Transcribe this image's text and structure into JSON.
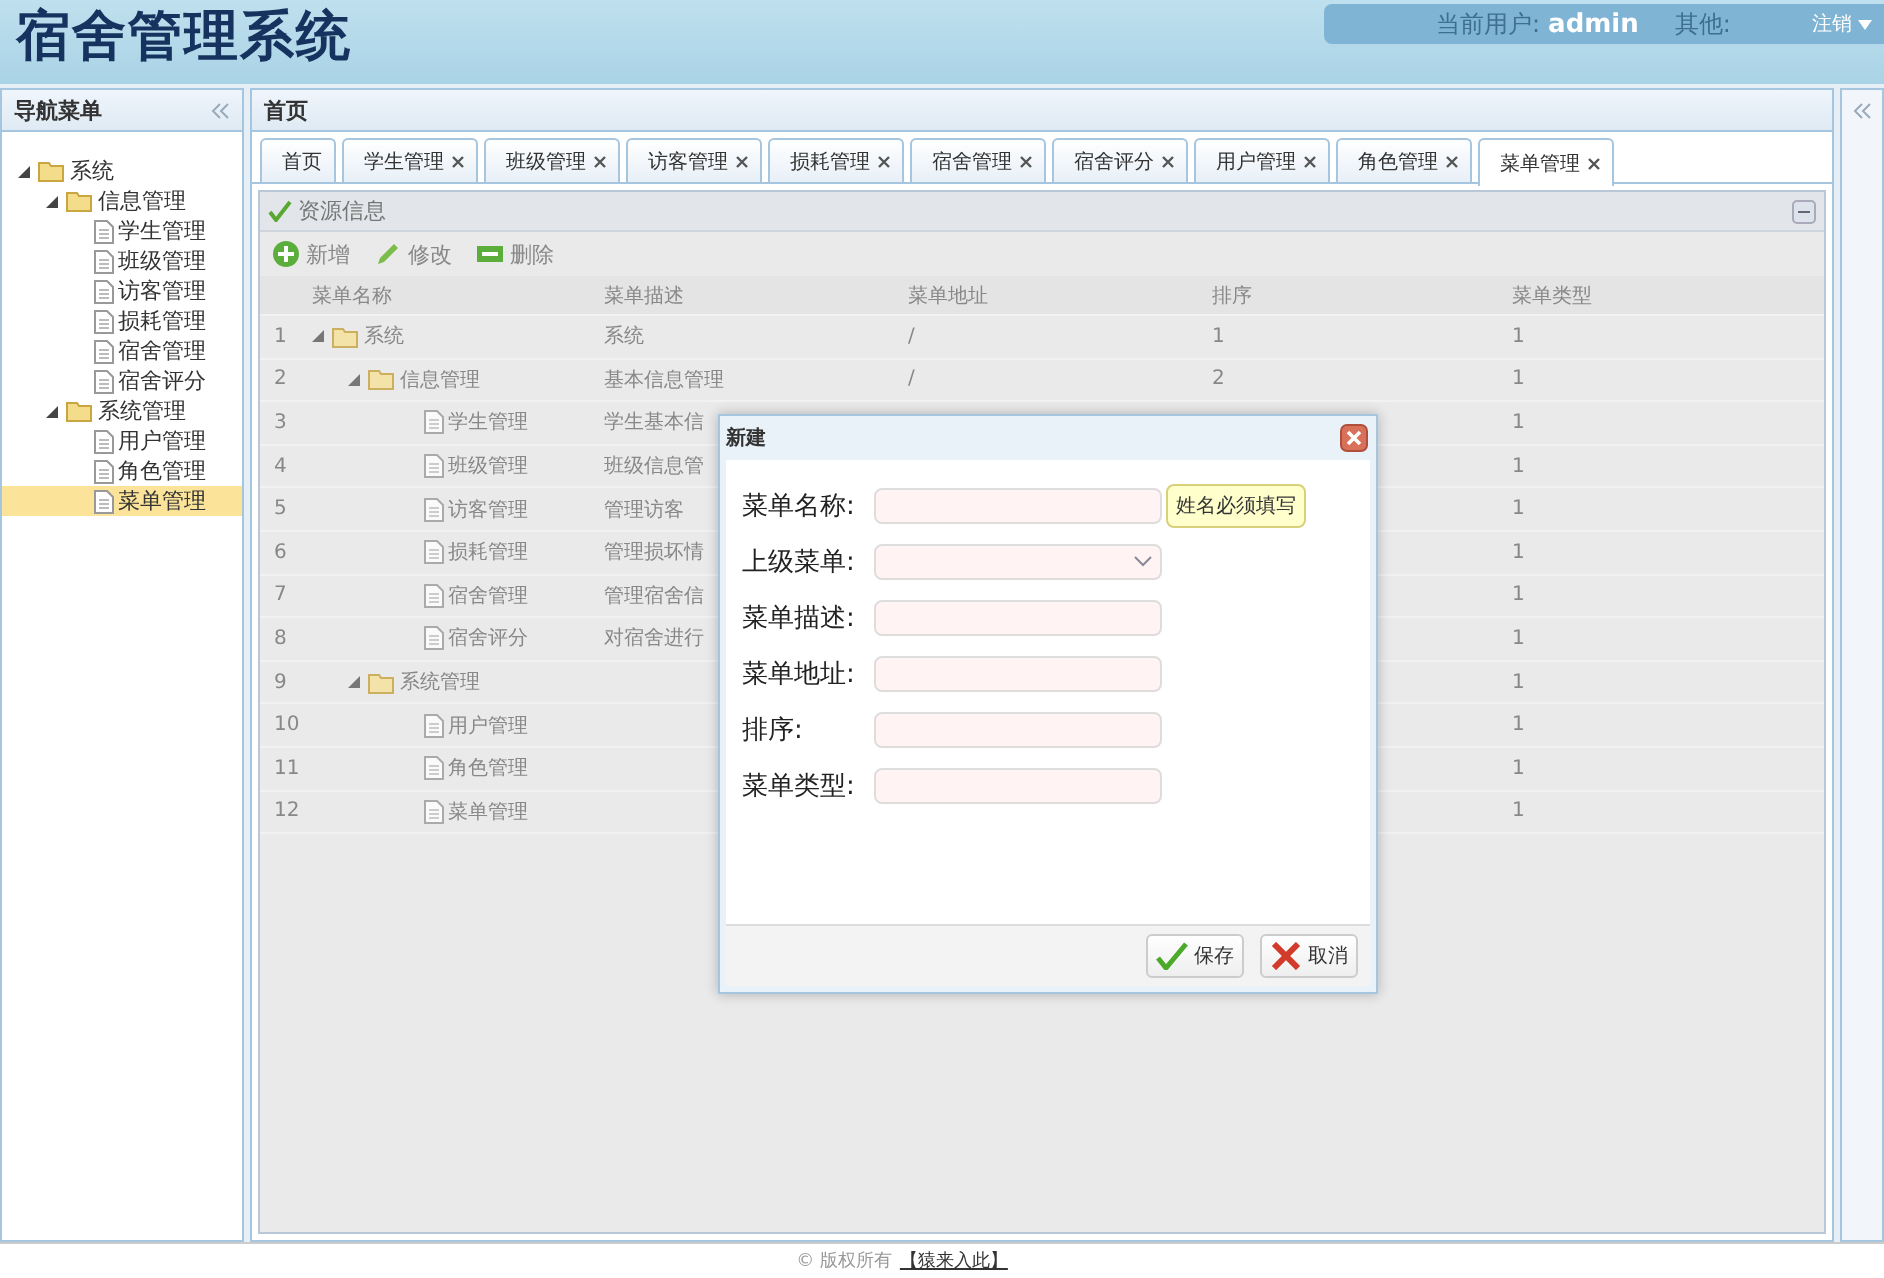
{
  "header": {
    "title": "宿舍管理系统",
    "user_label": "当前用户:",
    "user": "admin",
    "other_label": "其他:",
    "logout": "注销"
  },
  "sidebar": {
    "title": "导航菜单",
    "items": [
      {
        "label": "系统",
        "expanded": true,
        "selected": false,
        "children": [
          {
            "label": "信息管理",
            "expanded": true,
            "selected": false,
            "children": [
              {
                "label": "学生管理",
                "selected": false
              },
              {
                "label": "班级管理",
                "selected": false
              },
              {
                "label": "访客管理",
                "selected": false
              },
              {
                "label": "损耗管理",
                "selected": false
              },
              {
                "label": "宿舍管理",
                "selected": false
              },
              {
                "label": "宿舍评分",
                "selected": false
              }
            ]
          },
          {
            "label": "系统管理",
            "expanded": true,
            "selected": false,
            "children": [
              {
                "label": "用户管理",
                "selected": false
              },
              {
                "label": "角色管理",
                "selected": false
              },
              {
                "label": "菜单管理",
                "selected": true
              }
            ]
          }
        ]
      }
    ]
  },
  "main": {
    "title": "首页"
  },
  "tabs": [
    {
      "label": "首页",
      "closable": false,
      "selected": false
    },
    {
      "label": "学生管理",
      "closable": true,
      "selected": false
    },
    {
      "label": "班级管理",
      "closable": true,
      "selected": false
    },
    {
      "label": "访客管理",
      "closable": true,
      "selected": false
    },
    {
      "label": "损耗管理",
      "closable": true,
      "selected": false
    },
    {
      "label": "宿舍管理",
      "closable": true,
      "selected": false
    },
    {
      "label": "宿舍评分",
      "closable": true,
      "selected": false
    },
    {
      "label": "用户管理",
      "closable": true,
      "selected": false
    },
    {
      "label": "角色管理",
      "closable": true,
      "selected": false
    },
    {
      "label": "菜单管理",
      "closable": true,
      "selected": true
    }
  ],
  "panel": {
    "title": "资源信息"
  },
  "toolbar": [
    {
      "kind": "add",
      "label": "新增"
    },
    {
      "kind": "edit",
      "label": "修改"
    },
    {
      "kind": "delete",
      "label": "删除"
    }
  ],
  "table": {
    "columns": [
      "菜单名称",
      "菜单描述",
      "菜单地址",
      "排序",
      "菜单类型"
    ],
    "rows": [
      {
        "num": "1",
        "name": "系统",
        "desc": "系统",
        "url": "/",
        "sort": "1",
        "type": "1",
        "expanded": true,
        "children": [
          {
            "num": "2",
            "name": "信息管理",
            "desc": "基本信息管理",
            "url": "/",
            "sort": "2",
            "type": "1",
            "expanded": true,
            "children": [
              {
                "num": "3",
                "name": "学生管理",
                "desc": "学生基本信",
                "type": "1"
              },
              {
                "num": "4",
                "name": "班级管理",
                "desc": "班级信息管",
                "type": "1"
              },
              {
                "num": "5",
                "name": "访客管理",
                "desc": "管理访客",
                "type": "1"
              },
              {
                "num": "6",
                "name": "损耗管理",
                "desc": "管理损坏情",
                "type": "1"
              },
              {
                "num": "7",
                "name": "宿舍管理",
                "desc": "管理宿舍信",
                "type": "1"
              },
              {
                "num": "8",
                "name": "宿舍评分",
                "desc": "对宿舍进行",
                "type": "1"
              }
            ]
          },
          {
            "num": "9",
            "name": "系统管理",
            "type": "1",
            "expanded": true,
            "children": [
              {
                "num": "10",
                "name": "用户管理",
                "type": "1"
              },
              {
                "num": "11",
                "name": "角色管理",
                "type": "1"
              },
              {
                "num": "12",
                "name": "菜单管理",
                "type": "1"
              }
            ]
          }
        ]
      }
    ]
  },
  "dialog": {
    "title": "新建",
    "fields": [
      {
        "label": "菜单名称:",
        "kind": "text",
        "tooltip": "姓名必须填写"
      },
      {
        "label": "上级菜单:",
        "kind": "select"
      },
      {
        "label": "菜单描述:",
        "kind": "text"
      },
      {
        "label": "菜单地址:",
        "kind": "text"
      },
      {
        "label": "排序:",
        "kind": "text"
      },
      {
        "label": "菜单类型:",
        "kind": "text"
      }
    ],
    "buttons": [
      {
        "kind": "save",
        "label": "保存"
      },
      {
        "kind": "cancel",
        "label": "取消"
      }
    ]
  },
  "footer": {
    "copyright": "© 版权所有",
    "link": "【猿来入此】"
  }
}
